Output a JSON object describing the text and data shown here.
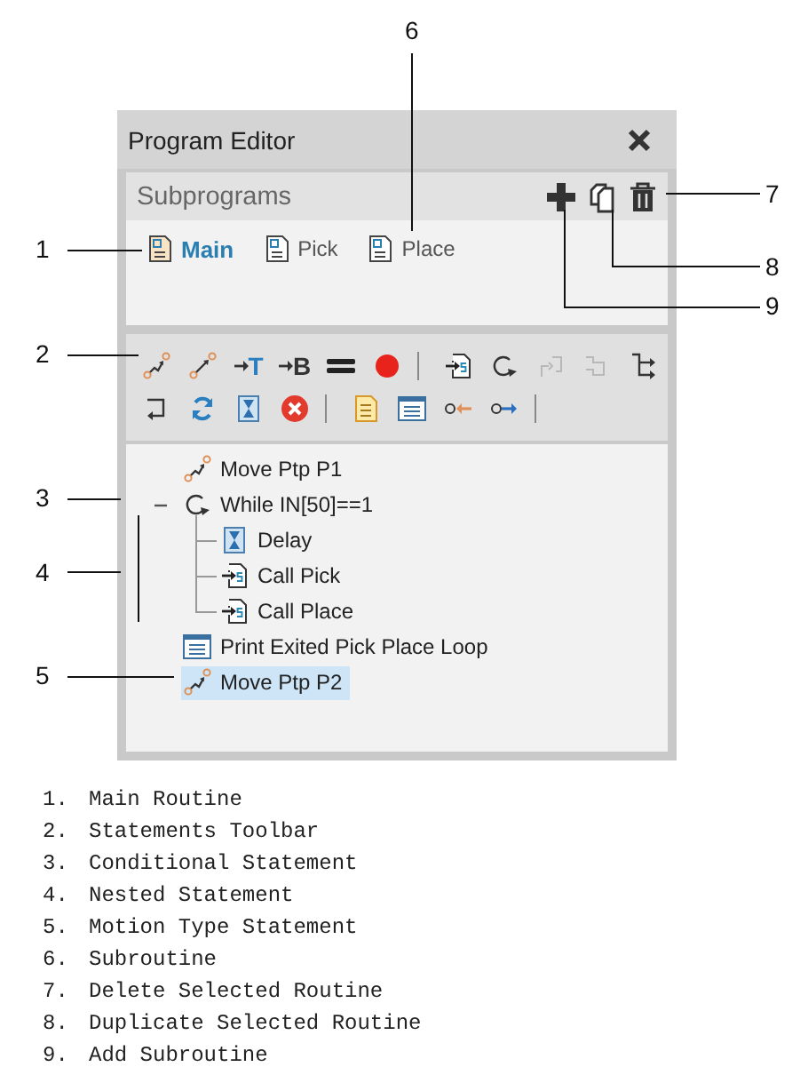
{
  "window": {
    "title": "Program Editor"
  },
  "subprograms": {
    "heading": "Subprograms",
    "items": [
      {
        "label": "Main",
        "kind": "main",
        "selected": true
      },
      {
        "label": "Pick",
        "kind": "sub",
        "selected": false
      },
      {
        "label": "Place",
        "kind": "sub",
        "selected": false
      }
    ]
  },
  "toolbar": {
    "rows": [
      [
        {
          "kind": "move-ptp",
          "disabled": false
        },
        {
          "kind": "move-lin",
          "disabled": false
        },
        {
          "kind": "set",
          "label": "T",
          "disabled": false
        },
        {
          "kind": "set",
          "label": "B",
          "disabled": false
        },
        {
          "kind": "equals",
          "disabled": false
        },
        {
          "kind": "record",
          "disabled": false
        },
        {
          "kind": "separator",
          "disabled": false
        },
        {
          "kind": "call",
          "disabled": false
        },
        {
          "kind": "while",
          "disabled": false
        },
        {
          "kind": "bracket",
          "disabled": true
        },
        {
          "kind": "bracket2",
          "disabled": true
        },
        {
          "kind": "branch",
          "disabled": false
        }
      ],
      [
        {
          "kind": "return",
          "disabled": false
        },
        {
          "kind": "loop",
          "disabled": false
        },
        {
          "kind": "delay",
          "disabled": false
        },
        {
          "kind": "stop",
          "disabled": false
        },
        {
          "kind": "separator",
          "disabled": false
        },
        {
          "kind": "note",
          "disabled": false
        },
        {
          "kind": "print",
          "disabled": false
        },
        {
          "kind": "input",
          "disabled": false
        },
        {
          "kind": "output",
          "disabled": false
        },
        {
          "kind": "separator",
          "disabled": false
        }
      ]
    ]
  },
  "tree": [
    {
      "label": "Move Ptp P1",
      "kind": "move-ptp",
      "selected": false
    },
    {
      "label": "While IN[50]==1",
      "kind": "while",
      "selected": false,
      "expanded": true,
      "children": [
        {
          "label": "Delay",
          "kind": "delay",
          "selected": false
        },
        {
          "label": "Call Pick",
          "kind": "call",
          "selected": false
        },
        {
          "label": "Call Place",
          "kind": "call",
          "selected": false
        }
      ]
    },
    {
      "label": "Print Exited Pick Place Loop",
      "kind": "print",
      "selected": false
    },
    {
      "label": "Move Ptp P2",
      "kind": "move-ptp",
      "selected": true
    }
  ],
  "callouts": [
    "1",
    "2",
    "3",
    "4",
    "5",
    "6",
    "7",
    "8",
    "9"
  ],
  "legend": [
    {
      "number": "1.",
      "text": "Main Routine"
    },
    {
      "number": "2.",
      "text": "Statements Toolbar"
    },
    {
      "number": "3.",
      "text": "Conditional Statement"
    },
    {
      "number": "4.",
      "text": "Nested Statement"
    },
    {
      "number": "5.",
      "text": "Motion Type Statement"
    },
    {
      "number": "6.",
      "text": "Subroutine"
    },
    {
      "number": "7.",
      "text": "Delete Selected Routine"
    },
    {
      "number": "8.",
      "text": "Duplicate Selected Routine"
    },
    {
      "number": "9.",
      "text": "Add Subroutine"
    }
  ]
}
